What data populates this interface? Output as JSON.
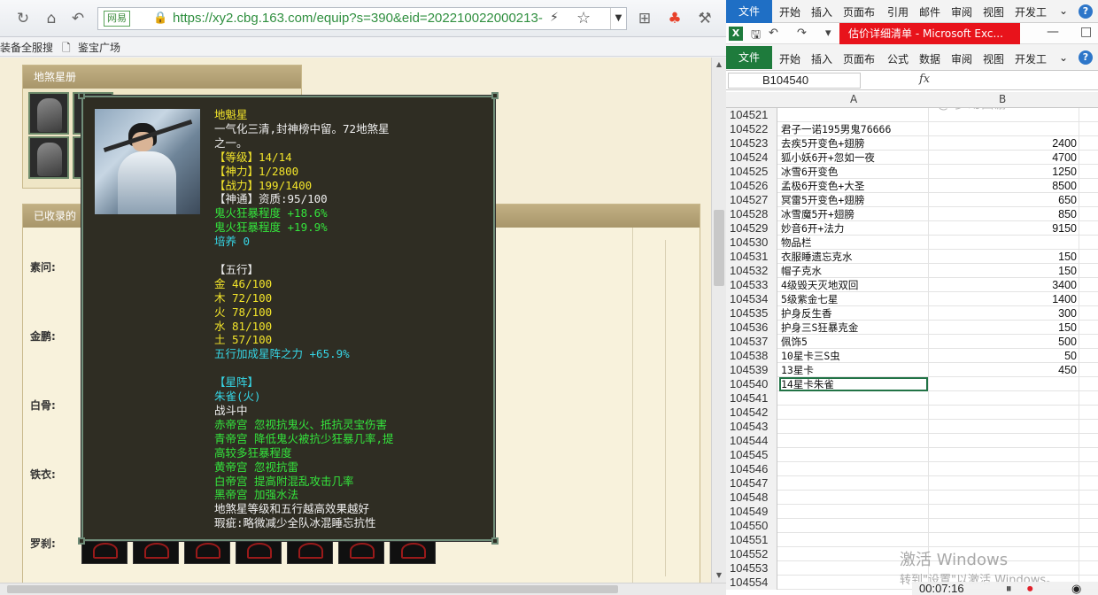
{
  "browser": {
    "address": {
      "site_tag": "网易",
      "url": "https://xy2.cbg.163.com/equip?s=390&eid=202210022000213-"
    },
    "bookmarks": [
      "装备全服搜",
      "鉴宝广场"
    ],
    "panel1_title": "地煞星册",
    "panel2_title": "已收录的",
    "row_labels": [
      "素问:",
      "金鹏:",
      "白骨:",
      "铁衣:",
      "罗刹:"
    ]
  },
  "tooltip": {
    "lines": [
      {
        "t": "地魁星",
        "c": "yel"
      },
      {
        "t": "一气化三清,封神榜中留。72地煞星",
        "c": "wht"
      },
      {
        "t": "之一。",
        "c": "wht"
      },
      {
        "t": "【等级】14/14",
        "c": "yel"
      },
      {
        "t": "【神力】1/2800",
        "c": "yel"
      },
      {
        "t": "【战力】199/1400",
        "c": "yel"
      },
      {
        "t": "【神通】资质:95/100",
        "c": "wht"
      },
      {
        "t": "鬼火狂暴程度 +18.6%",
        "c": "grn"
      },
      {
        "t": "鬼火狂暴程度 +19.9%",
        "c": "grn"
      },
      {
        "t": "培养 0",
        "c": "cyn"
      },
      {
        "t": "",
        "c": "wht"
      },
      {
        "t": "【五行】",
        "c": "wht"
      },
      {
        "t": "金 46/100",
        "c": "yel"
      },
      {
        "t": "木 72/100",
        "c": "yel"
      },
      {
        "t": "火 78/100",
        "c": "yel"
      },
      {
        "t": "水 81/100",
        "c": "yel"
      },
      {
        "t": "土 57/100",
        "c": "yel"
      },
      {
        "t": "五行加成星阵之力 +65.9%",
        "c": "cyn"
      },
      {
        "t": "",
        "c": "wht"
      },
      {
        "t": "【星阵】",
        "c": "cyn"
      },
      {
        "t": "朱雀(火)",
        "c": "cyn"
      },
      {
        "t": "战斗中",
        "c": "wht"
      },
      {
        "t": "赤帝宫 忽视抗鬼火、抵抗灵宝伤害",
        "c": "grn"
      },
      {
        "t": "青帝宫 降低鬼火被抗少狂暴几率,提",
        "c": "grn"
      },
      {
        "t": "高较多狂暴程度",
        "c": "grn"
      },
      {
        "t": "黄帝宫 忽视抗雷",
        "c": "grn"
      },
      {
        "t": "白帝宫 提高附混乱攻击几率",
        "c": "grn"
      },
      {
        "t": "黑帝宫 加强水法",
        "c": "grn"
      },
      {
        "t": "地煞星等级和五行越高效果越好",
        "c": "wht"
      },
      {
        "t": "瑕疵:略微减少全队冰混睡忘抗性",
        "c": "wht"
      }
    ]
  },
  "excel": {
    "ribbon_tabs": [
      "文件",
      "开始",
      "插入",
      "页面布",
      "引用",
      "邮件",
      "审阅",
      "视图",
      "开发工"
    ],
    "window_title": "估价详细清单 - Microsoft Exc...",
    "ribbon2_tabs": [
      "文件",
      "开始",
      "插入",
      "页面布",
      "公式",
      "数据",
      "审阅",
      "视图",
      "开发工"
    ],
    "name_box": "B104540",
    "fx": "fx",
    "columns": [
      "A",
      "B"
    ],
    "rows": [
      {
        "n": "104521",
        "a": "",
        "b": ""
      },
      {
        "n": "104522",
        "a": "君子一诺195男鬼76666",
        "b": ""
      },
      {
        "n": "104523",
        "a": "去疾5开变色+翅膀",
        "b": "2400"
      },
      {
        "n": "104524",
        "a": "狐小妖6开+忽如一夜",
        "b": "4700"
      },
      {
        "n": "104525",
        "a": "冰雪6开变色",
        "b": "1250"
      },
      {
        "n": "104526",
        "a": "孟极6开变色+大圣",
        "b": "8500"
      },
      {
        "n": "104527",
        "a": "冥雷5开变色+翅膀",
        "b": "650"
      },
      {
        "n": "104528",
        "a": "冰雪魔5开+翅膀",
        "b": "850"
      },
      {
        "n": "104529",
        "a": "妙音6开+法力",
        "b": "9150"
      },
      {
        "n": "104530",
        "a": "物品栏",
        "b": ""
      },
      {
        "n": "104531",
        "a": "衣服睡遗忘克水",
        "b": "150"
      },
      {
        "n": "104532",
        "a": "帽子克水",
        "b": "150"
      },
      {
        "n": "104533",
        "a": "4级毁天灭地双回",
        "b": "3400"
      },
      {
        "n": "104534",
        "a": "5级紫金七星",
        "b": "1400"
      },
      {
        "n": "104535",
        "a": "护身反生香",
        "b": "300"
      },
      {
        "n": "104536",
        "a": "护身三S狂暴克金",
        "b": "150"
      },
      {
        "n": "104537",
        "a": "佩饰5",
        "b": "500"
      },
      {
        "n": "104538",
        "a": "10星卡三S虫",
        "b": "50"
      },
      {
        "n": "104539",
        "a": "13星卡",
        "b": "450"
      },
      {
        "n": "104540",
        "a": "14星卡朱雀",
        "b": ""
      },
      {
        "n": "104541",
        "a": "",
        "b": ""
      },
      {
        "n": "104542",
        "a": "",
        "b": ""
      },
      {
        "n": "104543",
        "a": "",
        "b": ""
      },
      {
        "n": "104544",
        "a": "",
        "b": ""
      },
      {
        "n": "104545",
        "a": "",
        "b": ""
      },
      {
        "n": "104546",
        "a": "",
        "b": ""
      },
      {
        "n": "104547",
        "a": "",
        "b": ""
      },
      {
        "n": "104548",
        "a": "",
        "b": ""
      },
      {
        "n": "104549",
        "a": "",
        "b": ""
      },
      {
        "n": "104550",
        "a": "",
        "b": ""
      },
      {
        "n": "104551",
        "a": "",
        "b": ""
      },
      {
        "n": "104552",
        "a": "",
        "b": ""
      },
      {
        "n": "104553",
        "a": "",
        "b": ""
      },
      {
        "n": "104554",
        "a": "",
        "b": ""
      }
    ],
    "activate_title": "激活 Windows",
    "activate_sub": "转到\"设置\"以激活 Windows。",
    "recorder_time": "00:07:16",
    "watermark": "@ 梦幻西游"
  }
}
